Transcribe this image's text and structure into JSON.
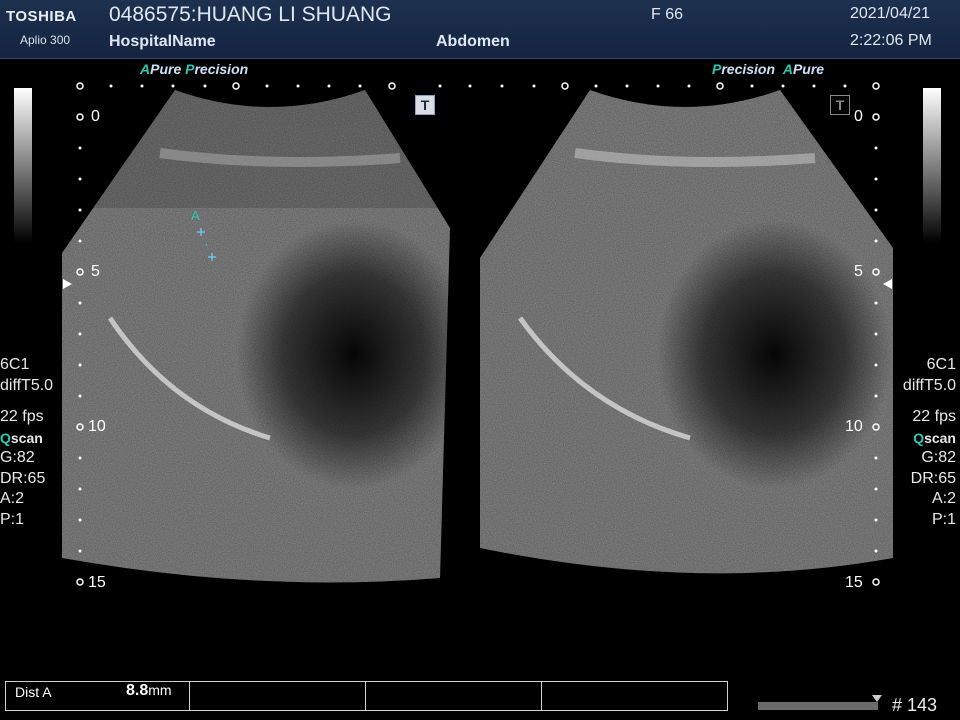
{
  "header": {
    "brand": "TOSHIBA",
    "model": "Aplio 300",
    "patient": "0486575:HUANG LI SHUANG",
    "hospital": "HospitalName",
    "exam": "Abdomen",
    "sex_age": "F  66",
    "date": "2021/04/21",
    "time": "2:22:06 PM"
  },
  "left_panel": {
    "mode_a": "A",
    "mode_a_text": "Pure",
    "mode_p": "P",
    "mode_p_text": "recision",
    "t_badge": "T",
    "depth_labels": [
      "0",
      "5",
      "10",
      "15"
    ],
    "params": {
      "probe": "6C1",
      "preset": "diffT5.0",
      "fps": "22 fps",
      "scan_q": "Q",
      "scan_rest": "scan",
      "gain": "G:82",
      "dr": "DR:65",
      "a": "A:2",
      "p": "P:1"
    },
    "caliper": {
      "label": "A"
    }
  },
  "right_panel": {
    "mode_p": "P",
    "mode_p_text": "recision",
    "mode_a": "A",
    "mode_a_text": "Pure",
    "t_badge": "T",
    "depth_labels": [
      "0",
      "5",
      "10",
      "15"
    ],
    "params": {
      "probe": "6C1",
      "preset": "diffT5.0",
      "fps": "22 fps",
      "scan_q": "Q",
      "scan_rest": "scan",
      "gain": "G:82",
      "dr": "DR:65",
      "a": "A:2",
      "p": "P:1"
    }
  },
  "measurement": {
    "label": "Dist A",
    "value": "8.8",
    "unit": "mm"
  },
  "footer": {
    "frame": "# 143"
  },
  "colors": {
    "header_bg": "#1d3150",
    "accent": "#2fc7b0",
    "caliper": "#6fd0ff"
  }
}
